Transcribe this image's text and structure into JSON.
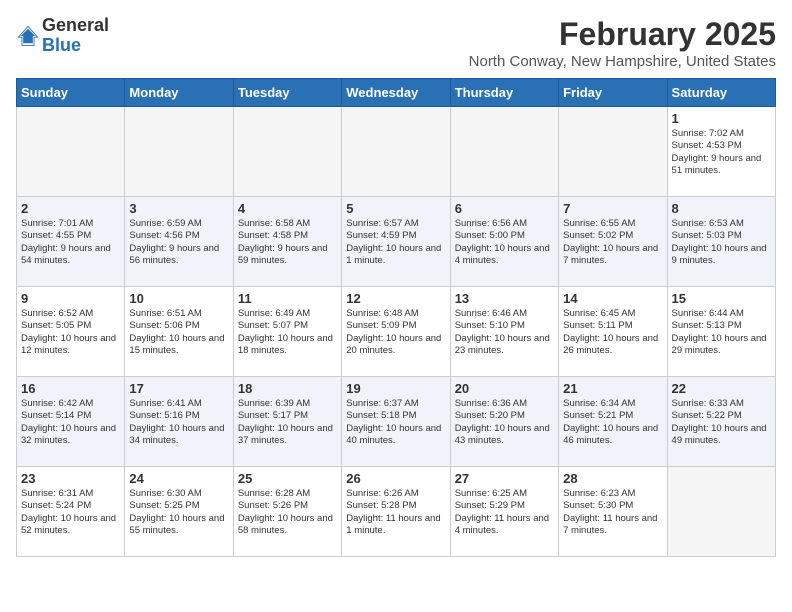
{
  "header": {
    "logo_general": "General",
    "logo_blue": "Blue",
    "month_year": "February 2025",
    "location": "North Conway, New Hampshire, United States"
  },
  "weekdays": [
    "Sunday",
    "Monday",
    "Tuesday",
    "Wednesday",
    "Thursday",
    "Friday",
    "Saturday"
  ],
  "weeks": [
    [
      {
        "day": "",
        "info": ""
      },
      {
        "day": "",
        "info": ""
      },
      {
        "day": "",
        "info": ""
      },
      {
        "day": "",
        "info": ""
      },
      {
        "day": "",
        "info": ""
      },
      {
        "day": "",
        "info": ""
      },
      {
        "day": "1",
        "info": "Sunrise: 7:02 AM\nSunset: 4:53 PM\nDaylight: 9 hours and 51 minutes."
      }
    ],
    [
      {
        "day": "2",
        "info": "Sunrise: 7:01 AM\nSunset: 4:55 PM\nDaylight: 9 hours and 54 minutes."
      },
      {
        "day": "3",
        "info": "Sunrise: 6:59 AM\nSunset: 4:56 PM\nDaylight: 9 hours and 56 minutes."
      },
      {
        "day": "4",
        "info": "Sunrise: 6:58 AM\nSunset: 4:58 PM\nDaylight: 9 hours and 59 minutes."
      },
      {
        "day": "5",
        "info": "Sunrise: 6:57 AM\nSunset: 4:59 PM\nDaylight: 10 hours and 1 minute."
      },
      {
        "day": "6",
        "info": "Sunrise: 6:56 AM\nSunset: 5:00 PM\nDaylight: 10 hours and 4 minutes."
      },
      {
        "day": "7",
        "info": "Sunrise: 6:55 AM\nSunset: 5:02 PM\nDaylight: 10 hours and 7 minutes."
      },
      {
        "day": "8",
        "info": "Sunrise: 6:53 AM\nSunset: 5:03 PM\nDaylight: 10 hours and 9 minutes."
      }
    ],
    [
      {
        "day": "9",
        "info": "Sunrise: 6:52 AM\nSunset: 5:05 PM\nDaylight: 10 hours and 12 minutes."
      },
      {
        "day": "10",
        "info": "Sunrise: 6:51 AM\nSunset: 5:06 PM\nDaylight: 10 hours and 15 minutes."
      },
      {
        "day": "11",
        "info": "Sunrise: 6:49 AM\nSunset: 5:07 PM\nDaylight: 10 hours and 18 minutes."
      },
      {
        "day": "12",
        "info": "Sunrise: 6:48 AM\nSunset: 5:09 PM\nDaylight: 10 hours and 20 minutes."
      },
      {
        "day": "13",
        "info": "Sunrise: 6:46 AM\nSunset: 5:10 PM\nDaylight: 10 hours and 23 minutes."
      },
      {
        "day": "14",
        "info": "Sunrise: 6:45 AM\nSunset: 5:11 PM\nDaylight: 10 hours and 26 minutes."
      },
      {
        "day": "15",
        "info": "Sunrise: 6:44 AM\nSunset: 5:13 PM\nDaylight: 10 hours and 29 minutes."
      }
    ],
    [
      {
        "day": "16",
        "info": "Sunrise: 6:42 AM\nSunset: 5:14 PM\nDaylight: 10 hours and 32 minutes."
      },
      {
        "day": "17",
        "info": "Sunrise: 6:41 AM\nSunset: 5:16 PM\nDaylight: 10 hours and 34 minutes."
      },
      {
        "day": "18",
        "info": "Sunrise: 6:39 AM\nSunset: 5:17 PM\nDaylight: 10 hours and 37 minutes."
      },
      {
        "day": "19",
        "info": "Sunrise: 6:37 AM\nSunset: 5:18 PM\nDaylight: 10 hours and 40 minutes."
      },
      {
        "day": "20",
        "info": "Sunrise: 6:36 AM\nSunset: 5:20 PM\nDaylight: 10 hours and 43 minutes."
      },
      {
        "day": "21",
        "info": "Sunrise: 6:34 AM\nSunset: 5:21 PM\nDaylight: 10 hours and 46 minutes."
      },
      {
        "day": "22",
        "info": "Sunrise: 6:33 AM\nSunset: 5:22 PM\nDaylight: 10 hours and 49 minutes."
      }
    ],
    [
      {
        "day": "23",
        "info": "Sunrise: 6:31 AM\nSunset: 5:24 PM\nDaylight: 10 hours and 52 minutes."
      },
      {
        "day": "24",
        "info": "Sunrise: 6:30 AM\nSunset: 5:25 PM\nDaylight: 10 hours and 55 minutes."
      },
      {
        "day": "25",
        "info": "Sunrise: 6:28 AM\nSunset: 5:26 PM\nDaylight: 10 hours and 58 minutes."
      },
      {
        "day": "26",
        "info": "Sunrise: 6:26 AM\nSunset: 5:28 PM\nDaylight: 11 hours and 1 minute."
      },
      {
        "day": "27",
        "info": "Sunrise: 6:25 AM\nSunset: 5:29 PM\nDaylight: 11 hours and 4 minutes."
      },
      {
        "day": "28",
        "info": "Sunrise: 6:23 AM\nSunset: 5:30 PM\nDaylight: 11 hours and 7 minutes."
      },
      {
        "day": "",
        "info": ""
      }
    ]
  ]
}
